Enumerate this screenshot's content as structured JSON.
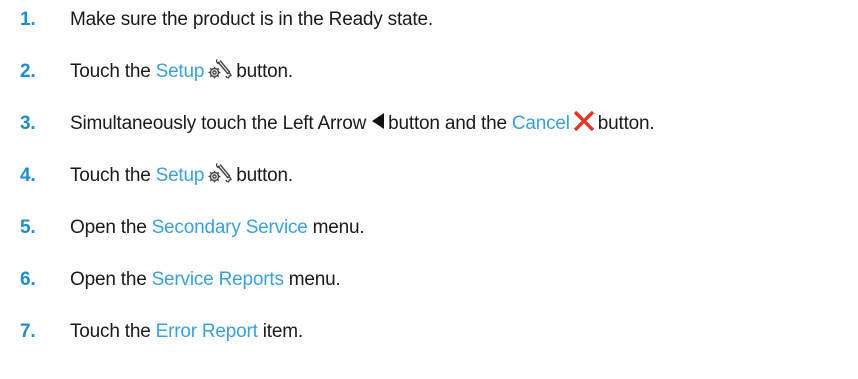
{
  "steps": [
    {
      "number": "1.",
      "parts": {
        "t1": "Make sure the product is in the Ready state."
      }
    },
    {
      "number": "2.",
      "parts": {
        "t1": "Touch the",
        "link1": "Setup",
        "icon1": "setup-wrench-gear-icon",
        "t2": "button."
      }
    },
    {
      "number": "3.",
      "parts": {
        "t1": "Simultaneously touch the Left Arrow",
        "icon1": "left-arrow-icon",
        "t2": "button and the",
        "link1": "Cancel",
        "icon2": "cancel-x-icon",
        "t3": "button."
      }
    },
    {
      "number": "4.",
      "parts": {
        "t1": "Touch the",
        "link1": "Setup",
        "icon1": "setup-wrench-gear-icon",
        "t2": "button."
      }
    },
    {
      "number": "5.",
      "parts": {
        "t1": "Open the",
        "link1": "Secondary Service",
        "t2": "menu."
      }
    },
    {
      "number": "6.",
      "parts": {
        "t1": "Open the",
        "link1": "Service Reports",
        "t2": "menu."
      }
    },
    {
      "number": "7.",
      "parts": {
        "t1": "Touch the",
        "link1": "Error Report",
        "t2": "item."
      }
    }
  ],
  "colors": {
    "step_number": "#1f8dc9",
    "link": "#3aa0d9",
    "cancel_icon": "#e53322",
    "body_text": "#1a1a1a"
  }
}
